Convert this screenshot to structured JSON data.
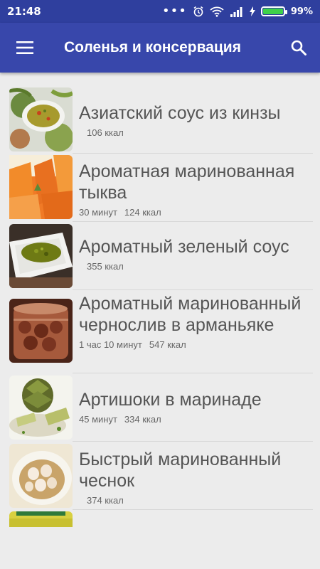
{
  "status": {
    "time": "21:48",
    "battery_pct": "99%",
    "battery_level": 0.99
  },
  "appbar": {
    "title": "Соленья и консервация",
    "menu_icon": "hamburger-menu-icon",
    "search_icon": "search-icon"
  },
  "items": [
    {
      "title": "Азиатский соус из кинзы",
      "time": "",
      "kcal": "106 ккал"
    },
    {
      "title": "Ароматная маринованная тыква",
      "time": "30 минут",
      "kcal": "124 ккал"
    },
    {
      "title": "Ароматный зеленый соус",
      "time": "",
      "kcal": "355 ккал"
    },
    {
      "title": "Ароматный маринованный чернослив в арманьяке",
      "time": "1 час 10 минут",
      "kcal": "547 ккал"
    },
    {
      "title": "Артишоки в маринаде",
      "time": "45 минут",
      "kcal": "334 ккал"
    },
    {
      "title": "Быстрый маринованный чеснок",
      "time": "",
      "kcal": "374 ккал"
    }
  ]
}
